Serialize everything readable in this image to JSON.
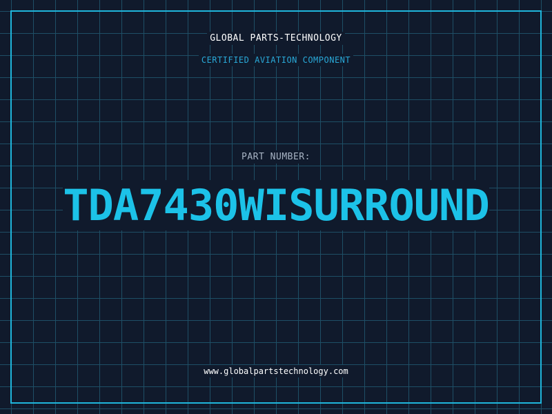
{
  "header": {
    "company": "GLOBAL PARTS-TECHNOLOGY",
    "tagline": "CERTIFIED AVIATION COMPONENT"
  },
  "main": {
    "label": "PART NUMBER:",
    "part_number": "TDA7430WISURROUND"
  },
  "footer": {
    "website": "www.globalpartstechnology.com"
  },
  "colors": {
    "background": "#101a2c",
    "grid": "#1e4f66",
    "accent": "#1cc2e8",
    "frame": "#1fb6dc"
  }
}
